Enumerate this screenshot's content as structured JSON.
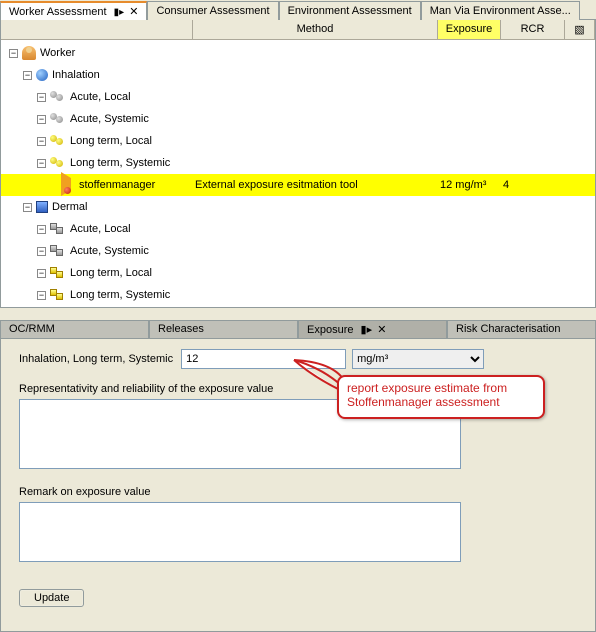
{
  "tabs_top": [
    {
      "label": "Worker Assessment",
      "active": true,
      "pinned": true,
      "closable": true
    },
    {
      "label": "Consumer Assessment"
    },
    {
      "label": "Environment Assessment"
    },
    {
      "label": "Man Via Environment Asse..."
    }
  ],
  "tree": {
    "headers": {
      "method": "Method",
      "exposure": "Exposure",
      "rcr": "RCR"
    },
    "root": {
      "label": "Worker"
    },
    "inhalation": {
      "label": "Inhalation",
      "children": [
        {
          "label": "Acute, Local",
          "tone": "gray"
        },
        {
          "label": "Acute, Systemic",
          "tone": "gray"
        },
        {
          "label": "Long term, Local",
          "tone": "yellow"
        },
        {
          "label": "Long term, Systemic",
          "tone": "yellow"
        }
      ],
      "leaf": {
        "label": "stoffenmanager",
        "method": "External exposure esitmation tool",
        "exposure": "12 mg/m³",
        "rcr": "4"
      }
    },
    "dermal": {
      "label": "Dermal",
      "children": [
        {
          "label": "Acute, Local",
          "tone": "gray"
        },
        {
          "label": "Acute, Systemic",
          "tone": "gray"
        },
        {
          "label": "Long term, Local",
          "tone": "yellow"
        },
        {
          "label": "Long term, Systemic",
          "tone": "yellow"
        }
      ]
    }
  },
  "sub_tabs": [
    {
      "label": "OC/RMM"
    },
    {
      "label": "Releases"
    },
    {
      "label": "Exposure",
      "active": true,
      "pinned": true,
      "closable": true
    },
    {
      "label": "Risk Characterisation"
    }
  ],
  "form": {
    "route_label": "Inhalation, Long term, Systemic",
    "value": "12",
    "unit": "mg/m³",
    "rep_label": "Representativity and reliability of the exposure value",
    "rep_value": "",
    "remark_label": "Remark on exposure value",
    "remark_value": "",
    "update_label": "Update"
  },
  "callout": {
    "text": "report exposure estimate from Stoffenmanager assessment"
  }
}
